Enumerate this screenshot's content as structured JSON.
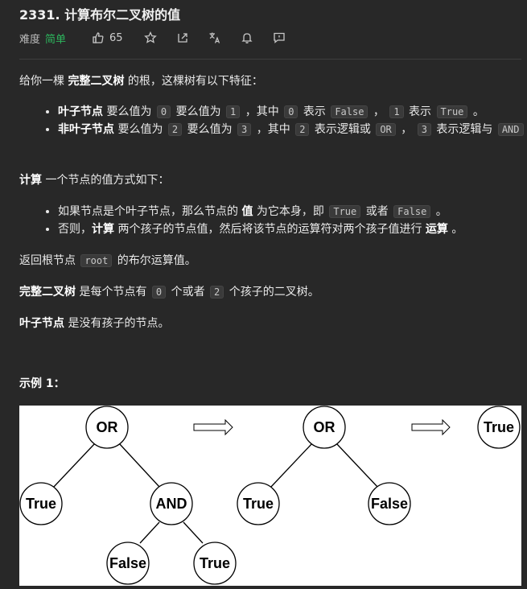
{
  "problem": {
    "title": "2331. 计算布尔二叉树的值",
    "difficulty_label": "难度",
    "difficulty_value": "简单",
    "likes": "65"
  },
  "description": {
    "intro": {
      "a": "给你一棵 ",
      "b": "完整二叉树",
      "c": " 的根，这棵树有以下特征："
    },
    "features": [
      {
        "b": "叶子节点",
        "t1": " 要么值为 ",
        "c1": "0",
        "t2": " 要么值为 ",
        "c2": "1",
        "t3": " ，其中 ",
        "c3": "0",
        "t4": " 表示 ",
        "c4": "False",
        "t5": " ， ",
        "c5": "1",
        "t6": " 表示 ",
        "c6": "True",
        "t7": " 。"
      },
      {
        "b": "非叶子节点",
        "t1": " 要么值为 ",
        "c1": "2",
        "t2": " 要么值为 ",
        "c2": "3",
        "t3": " ，其中 ",
        "c3": "2",
        "t4": " 表示逻辑或 ",
        "c4": "OR",
        "t5": " ， ",
        "c5": "3",
        "t6": " 表示逻辑与 ",
        "c6": "AND",
        "t7": " 。"
      }
    ],
    "compute_intro": {
      "b": "计算",
      "a": " 一个节点的值方式如下："
    },
    "compute_rules": [
      {
        "t1": "如果节点是个叶子节点，那么节点的 ",
        "b": "值",
        "t2": " 为它本身，即 ",
        "c1": "True",
        "t3": " 或者 ",
        "c2": "False",
        "t4": " 。"
      },
      {
        "t1": "否则，",
        "b1": "计算",
        "t2": " 两个孩子的节点值，然后将该节点的运算符对两个孩子值进行 ",
        "b2": "运算",
        "t3": " 。"
      }
    ],
    "return_line": {
      "a": "返回根节点 ",
      "c": "root",
      "b": " 的布尔运算值。"
    },
    "full_tree_def": {
      "b": "完整二叉树",
      "t1": " 是每个节点有 ",
      "c1": "0",
      "t2": " 个或者 ",
      "c2": "2",
      "t3": " 个孩子的二叉树。"
    },
    "leaf_def": {
      "b": "叶子节点",
      "t1": " 是没有孩子的节点。"
    },
    "example_title": "示例 1："
  },
  "figure": {
    "tree1": {
      "root": "OR",
      "left": "True",
      "right": "AND",
      "right_left": "False",
      "right_right": "True"
    },
    "tree2": {
      "root": "OR",
      "left": "True",
      "right": "False"
    },
    "result": "True"
  },
  "icons": [
    "thumbs-up-icon",
    "star-icon",
    "share-icon",
    "translate-icon",
    "bell-icon",
    "feedback-icon"
  ]
}
